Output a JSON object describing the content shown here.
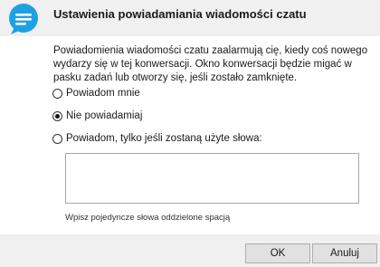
{
  "dialog": {
    "title": "Ustawienia powiadamiania wiadomości czatu",
    "description": "Powiadomienia wiadomości czatu zaalarmują cię, kiedy coś nowego wydarzy się w tej konwersacji. Okno konwersacji będzie migać w pasku zadań lub otworzy się, jeśli zostało zamknięte.",
    "icon": "chat-bubble-icon",
    "accent_color": "#1da1e2"
  },
  "options": [
    {
      "label": "Powiadom mnie",
      "checked": false
    },
    {
      "label": "Nie powiadamiaj",
      "checked": true
    },
    {
      "label": "Powiadom, tylko jeśli zostaną użyte słowa:",
      "checked": false
    }
  ],
  "words_input": {
    "value": ""
  },
  "hint": "Wpisz pojedyncze słowa oddzielone spacją",
  "buttons": {
    "ok": "OK",
    "cancel": "Anuluj"
  }
}
